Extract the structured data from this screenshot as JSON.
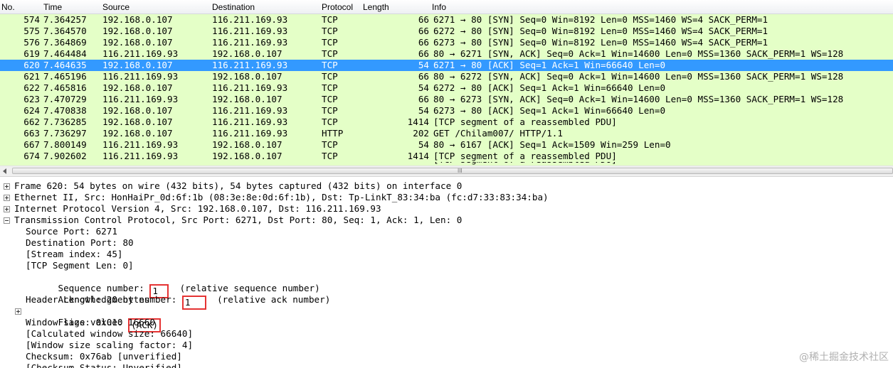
{
  "packet_list": {
    "columns": [
      "No.",
      "Time",
      "Source",
      "Destination",
      "Protocol",
      "Length",
      "Info"
    ],
    "rows": [
      {
        "no": "574",
        "time": "7.364257",
        "src": "192.168.0.107",
        "dst": "116.211.169.93",
        "proto": "TCP",
        "len": "66",
        "info": "6271 → 80 [SYN] Seq=0 Win=8192 Len=0 MSS=1460 WS=4 SACK_PERM=1"
      },
      {
        "no": "575",
        "time": "7.364570",
        "src": "192.168.0.107",
        "dst": "116.211.169.93",
        "proto": "TCP",
        "len": "66",
        "info": "6272 → 80 [SYN] Seq=0 Win=8192 Len=0 MSS=1460 WS=4 SACK_PERM=1"
      },
      {
        "no": "576",
        "time": "7.364869",
        "src": "192.168.0.107",
        "dst": "116.211.169.93",
        "proto": "TCP",
        "len": "66",
        "info": "6273 → 80 [SYN] Seq=0 Win=8192 Len=0 MSS=1460 WS=4 SACK_PERM=1"
      },
      {
        "no": "619",
        "time": "7.464484",
        "src": "116.211.169.93",
        "dst": "192.168.0.107",
        "proto": "TCP",
        "len": "66",
        "info": "80 → 6271 [SYN, ACK] Seq=0 Ack=1 Win=14600 Len=0 MSS=1360 SACK_PERM=1 WS=128"
      },
      {
        "no": "620",
        "time": "7.464635",
        "src": "192.168.0.107",
        "dst": "116.211.169.93",
        "proto": "TCP",
        "len": "54",
        "info": "6271 → 80 [ACK] Seq=1 Ack=1 Win=66640 Len=0",
        "selected": true
      },
      {
        "no": "621",
        "time": "7.465196",
        "src": "116.211.169.93",
        "dst": "192.168.0.107",
        "proto": "TCP",
        "len": "66",
        "info": "80 → 6272 [SYN, ACK] Seq=0 Ack=1 Win=14600 Len=0 MSS=1360 SACK_PERM=1 WS=128"
      },
      {
        "no": "622",
        "time": "7.465816",
        "src": "192.168.0.107",
        "dst": "116.211.169.93",
        "proto": "TCP",
        "len": "54",
        "info": "6272 → 80 [ACK] Seq=1 Ack=1 Win=66640 Len=0"
      },
      {
        "no": "623",
        "time": "7.470729",
        "src": "116.211.169.93",
        "dst": "192.168.0.107",
        "proto": "TCP",
        "len": "66",
        "info": "80 → 6273 [SYN, ACK] Seq=0 Ack=1 Win=14600 Len=0 MSS=1360 SACK_PERM=1 WS=128"
      },
      {
        "no": "624",
        "time": "7.470838",
        "src": "192.168.0.107",
        "dst": "116.211.169.93",
        "proto": "TCP",
        "len": "54",
        "info": "6273 → 80 [ACK] Seq=1 Ack=1 Win=66640 Len=0"
      },
      {
        "no": "662",
        "time": "7.736285",
        "src": "192.168.0.107",
        "dst": "116.211.169.93",
        "proto": "TCP",
        "len": "1414",
        "info": "[TCP segment of a reassembled PDU]"
      },
      {
        "no": "663",
        "time": "7.736297",
        "src": "192.168.0.107",
        "dst": "116.211.169.93",
        "proto": "HTTP",
        "len": "202",
        "info": "GET /Chilam007/ HTTP/1.1"
      },
      {
        "no": "667",
        "time": "7.800149",
        "src": "116.211.169.93",
        "dst": "192.168.0.107",
        "proto": "TCP",
        "len": "54",
        "info": "80 → 6167 [ACK] Seq=1 Ack=1509 Win=259 Len=0"
      },
      {
        "no": "674",
        "time": "7.902602",
        "src": "116.211.169.93",
        "dst": "192.168.0.107",
        "proto": "TCP",
        "len": "1414",
        "info": "[TCP segment of a reassembled PDU]"
      }
    ],
    "partial_row_info": "[TCP segment of a reassembled PDU]"
  },
  "scrollbar": {
    "grip": "III"
  },
  "details": {
    "frame": "Frame 620: 54 bytes on wire (432 bits), 54 bytes captured (432 bits) on interface 0",
    "ethernet": "Ethernet II, Src: HonHaiPr_0d:6f:1b (08:3e:8e:0d:6f:1b), Dst: Tp-LinkT_83:34:ba (fc:d7:33:83:34:ba)",
    "ip": "Internet Protocol Version 4, Src: 192.168.0.107, Dst: 116.211.169.93",
    "tcp": "Transmission Control Protocol, Src Port: 6271, Dst Port: 80, Seq: 1, Ack: 1, Len: 0",
    "tcp_fields": {
      "src_port": "Source Port: 6271",
      "dst_port": "Destination Port: 80",
      "stream_index": "[Stream index: 45]",
      "segment_len": "[TCP Segment Len: 0]",
      "seq_label": "Sequence number: ",
      "seq_value": "1",
      "seq_note": "(relative sequence number)",
      "ack_label": "Acknowledgment number: ",
      "ack_value": "1",
      "ack_note": "(relative ack number)",
      "header_length": "Header Length: 20 bytes",
      "flags_label": "Flags: 0x010 ",
      "flags_value": "(ACK)",
      "window_size": "Window size value: 16660",
      "calc_window": "[Calculated window size: 66640]",
      "scaling": "[Window size scaling factor: 4]",
      "checksum": "Checksum: 0x76ab [unverified]",
      "checksum_status": "[Checksum Status: Unverified]"
    }
  },
  "watermark": "@稀土掘金技术社区",
  "colors": {
    "row_bg": "#e4ffc7",
    "selected_bg": "#3399ff",
    "highlight_box": "#e53333"
  }
}
